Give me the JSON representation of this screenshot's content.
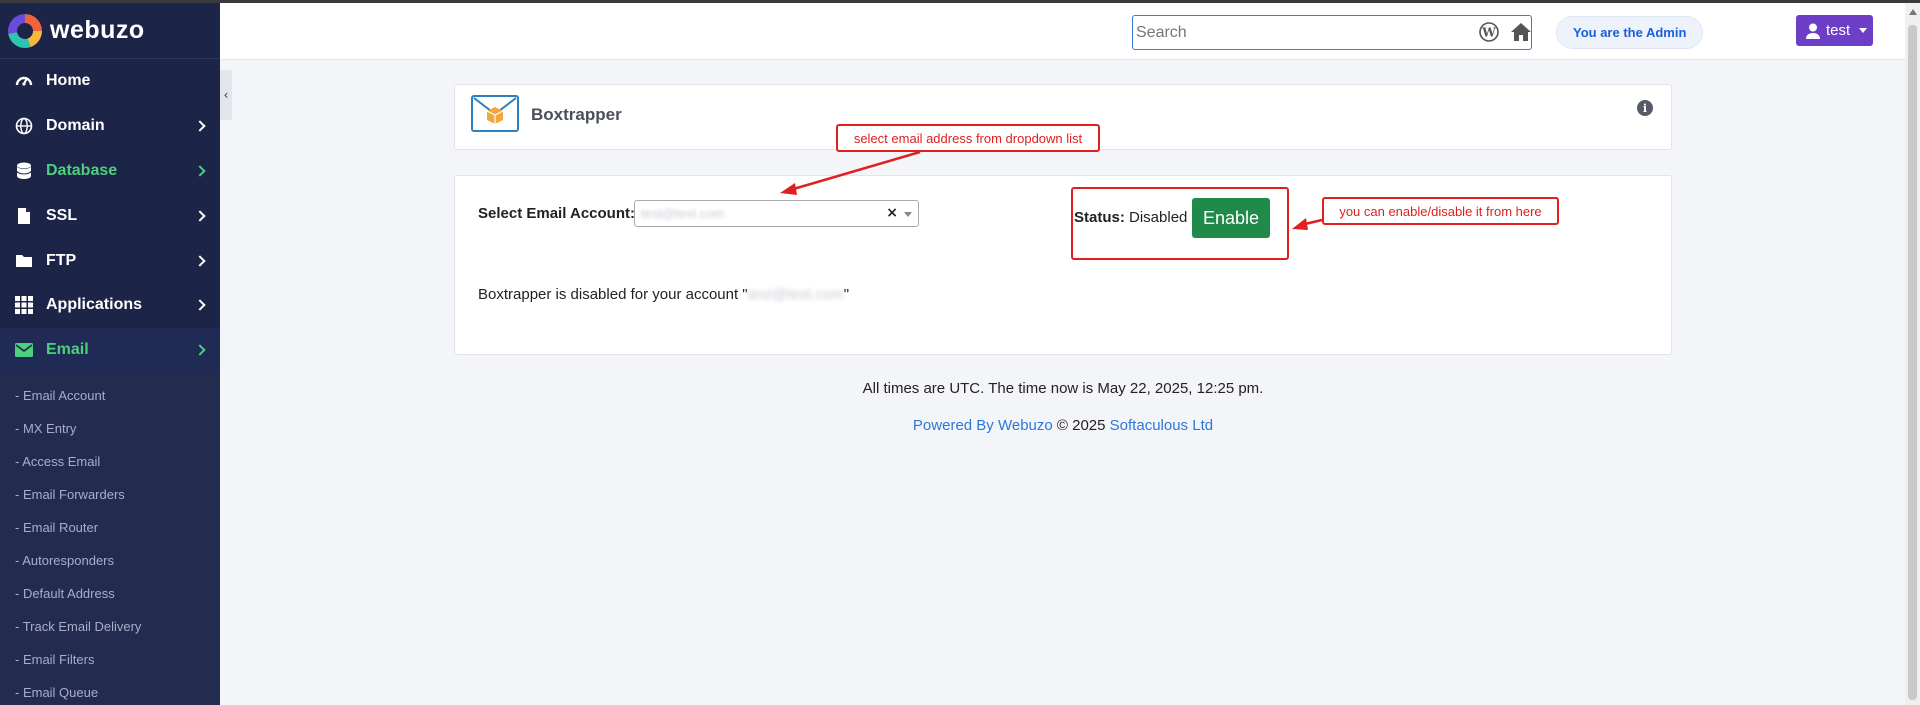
{
  "brand": {
    "name": "webuzo"
  },
  "sidebar": {
    "items": [
      {
        "label": "Home",
        "icon": "dashboard-icon"
      },
      {
        "label": "Domain",
        "icon": "globe-icon"
      },
      {
        "label": "Database",
        "icon": "database-icon"
      },
      {
        "label": "SSL",
        "icon": "file-icon"
      },
      {
        "label": "FTP",
        "icon": "folder-icon"
      },
      {
        "label": "Applications",
        "icon": "grid-icon"
      },
      {
        "label": "Email",
        "icon": "envelope-icon"
      }
    ],
    "email_subitems": [
      "- Email Account",
      "- MX Entry",
      "- Access Email",
      "- Email Forwarders",
      "- Email Router",
      "- Autoresponders",
      "- Default Address",
      "- Track Email Delivery",
      "- Email Filters",
      "- Email Queue"
    ],
    "collapse_glyph": "‹"
  },
  "header": {
    "search_placeholder": "Search",
    "admin_label": "You are the Admin",
    "user_label": "test"
  },
  "page": {
    "title": "Boxtrapper",
    "select_label": "Select Email Account:",
    "select_value": "test@test.com",
    "clear_glyph": "×",
    "status_label": "Status:",
    "status_value": "Disabled",
    "enable_label": "Enable",
    "note_prefix": "Boxtrapper is disabled for your account \"",
    "note_account": "test@test.com",
    "note_suffix": "\""
  },
  "annotations": {
    "dropdown_hint": "select email address from dropdown list",
    "enable_hint": "you can enable/disable it from here",
    "color": "#e02020"
  },
  "footer": {
    "time_text": "All times are UTC. The time now is May 22, 2025, 12:25 pm.",
    "powered_by": "Powered By Webuzo",
    "copyright": "© 2025",
    "company": "Softaculous Ltd"
  },
  "colors": {
    "sidebar_bg": "#1c2448",
    "accent_green": "#4cd07d",
    "enable_green": "#1f8a4a",
    "user_purple": "#6d3fc7",
    "link_blue": "#2a79d8"
  }
}
